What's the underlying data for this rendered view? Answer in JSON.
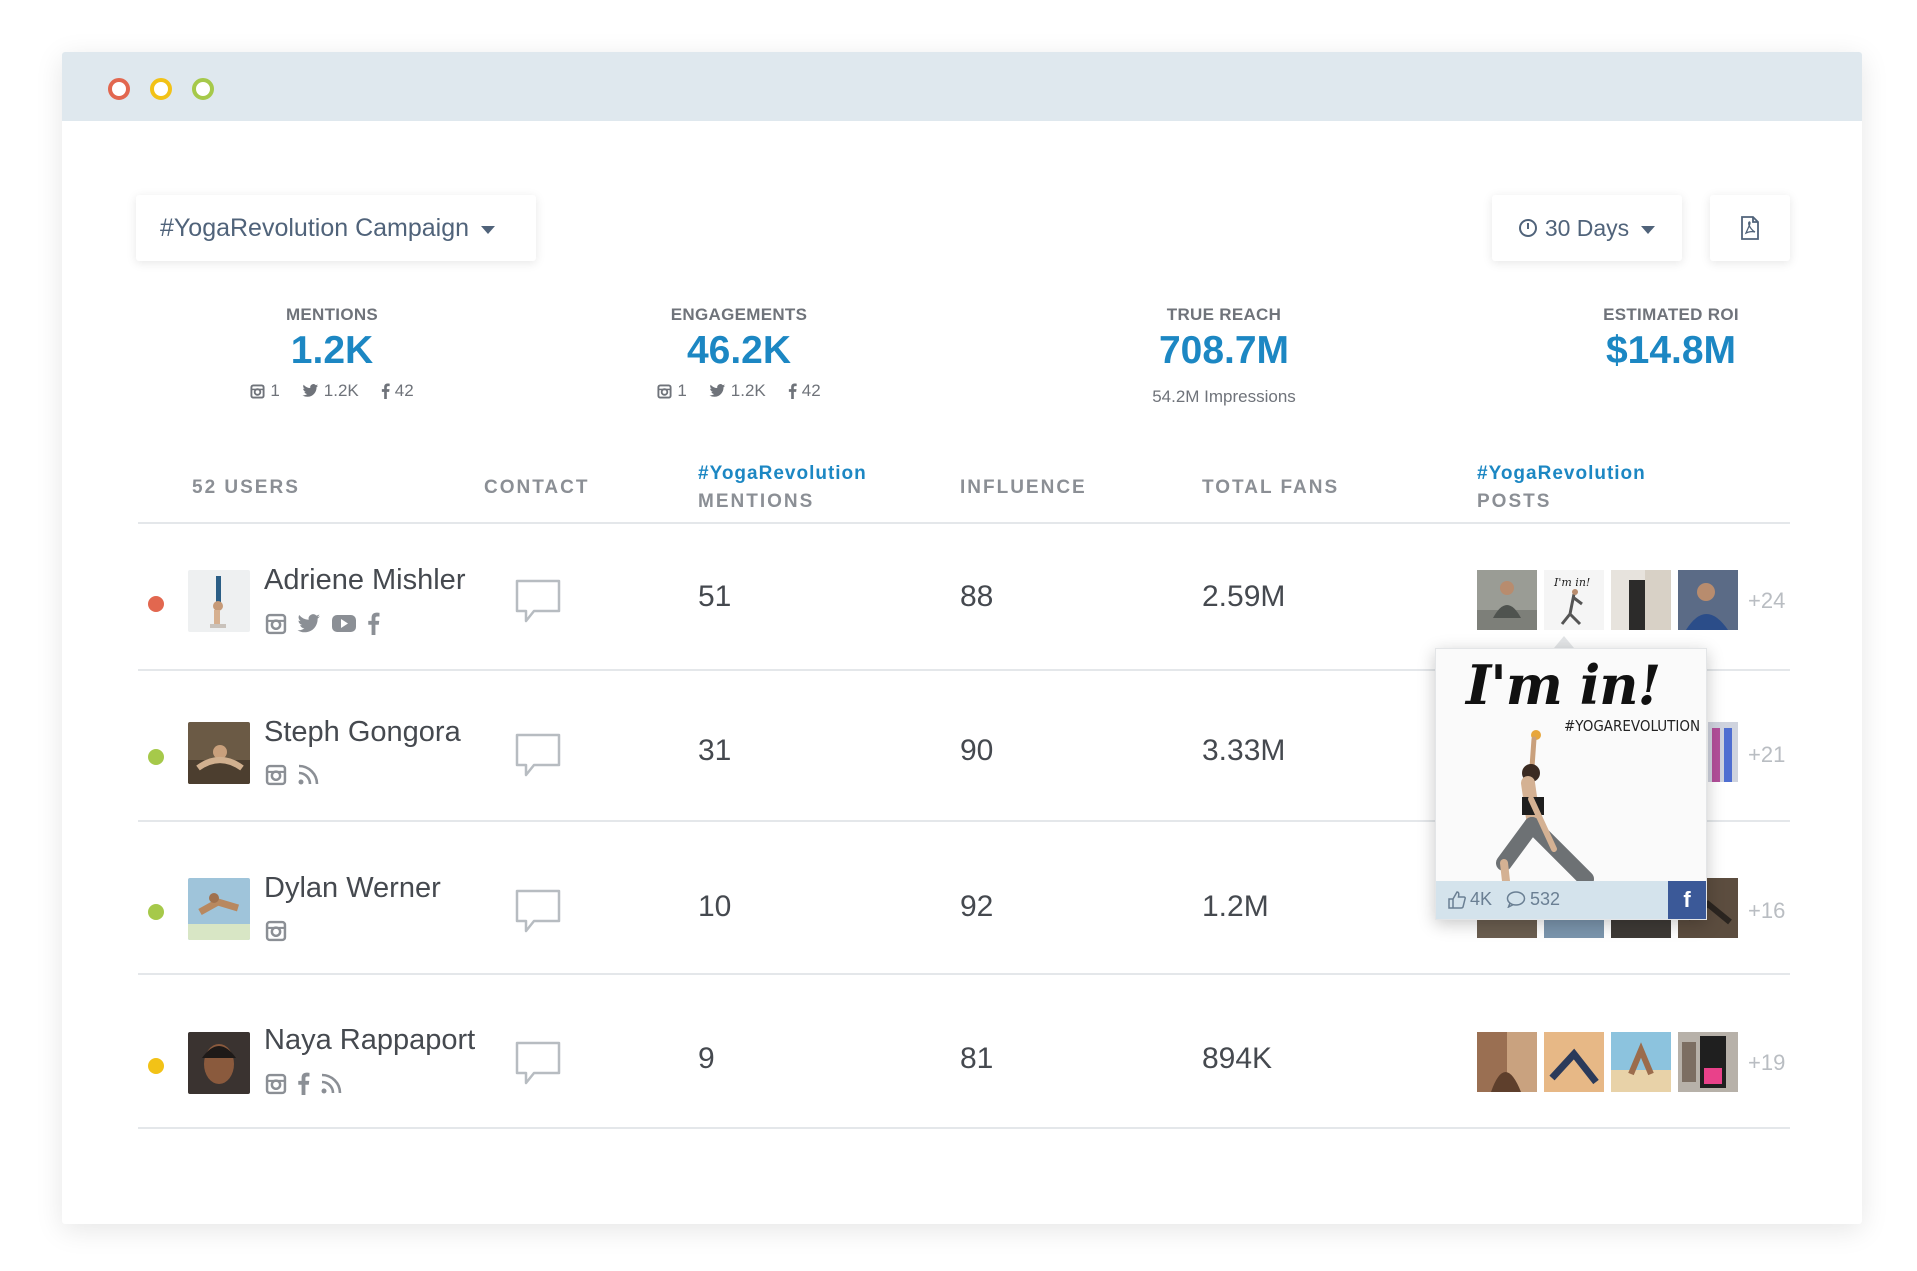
{
  "header": {
    "campaign_label": "#YogaRevolution Campaign",
    "range_label": "30 Days"
  },
  "stats": [
    {
      "label": "MENTIONS",
      "value": "1.2K",
      "instagram": "1",
      "twitter": "1.2K",
      "facebook": "42"
    },
    {
      "label": "ENGAGEMENTS",
      "value": "46.2K",
      "instagram": "1",
      "twitter": "1.2K",
      "facebook": "42"
    },
    {
      "label": "TRUE REACH",
      "value": "708.7M",
      "note": "54.2M Impressions"
    },
    {
      "label": "ESTIMATED ROI",
      "value": "$14.8M"
    }
  ],
  "table": {
    "headers": {
      "users": "52 USERS",
      "contact": "CONTACT",
      "mentions_tag": "#YogaRevolution",
      "mentions": "MENTIONS",
      "influence": "INFLUENCE",
      "total_fans": "TOTAL FANS",
      "posts_tag": "#YogaRevolution",
      "posts": "POSTS"
    },
    "rows": [
      {
        "status_color": "#e2674f",
        "name": "Adriene Mishler",
        "socials": [
          "instagram-icon",
          "twitter-icon",
          "youtube-icon",
          "facebook-icon"
        ],
        "mentions": "51",
        "influence": "88",
        "fans": "2.59M",
        "more": "+24"
      },
      {
        "status_color": "#a6c94a",
        "name": "Steph Gongora",
        "socials": [
          "instagram-icon",
          "rss-icon"
        ],
        "mentions": "31",
        "influence": "90",
        "fans": "3.33M",
        "more": "+21"
      },
      {
        "status_color": "#a6c94a",
        "name": "Dylan Werner",
        "socials": [
          "instagram-icon"
        ],
        "mentions": "10",
        "influence": "92",
        "fans": "1.2M",
        "more": "+16"
      },
      {
        "status_color": "#f2c217",
        "name": "Naya Rappaport",
        "socials": [
          "instagram-icon",
          "facebook-icon",
          "rss-icon"
        ],
        "mentions": "9",
        "influence": "81",
        "fans": "894K",
        "more": "+19"
      }
    ]
  },
  "popup": {
    "title": "I'm in!",
    "tag": "#YOGAREVOLUTION",
    "likes": "4K",
    "comments": "532",
    "network": "f"
  }
}
